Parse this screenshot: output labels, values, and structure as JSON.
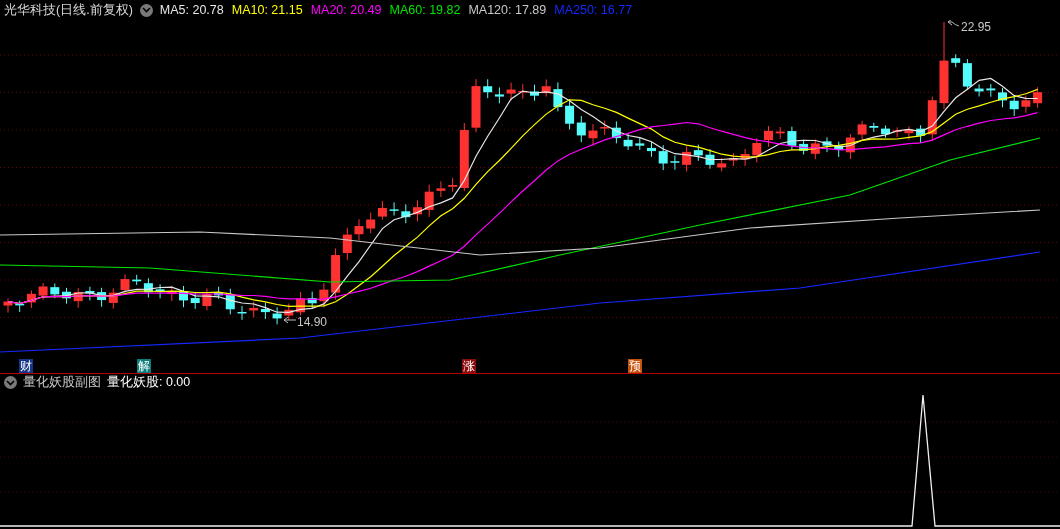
{
  "main_chart": {
    "title": "光华科技(日线.前复权)",
    "ma_legend": [
      {
        "label": "MA5: 20.78",
        "color": "#e6e6e6"
      },
      {
        "label": "MA10: 21.15",
        "color": "#ffff00"
      },
      {
        "label": "MA20: 20.49",
        "color": "#ff00ff"
      },
      {
        "label": "MA60: 19.82",
        "color": "#00e600"
      },
      {
        "label": "MA120: 17.89",
        "color": "#c8c8c8"
      },
      {
        "label": "MA250: 16.77",
        "color": "#1428ff"
      }
    ],
    "high_label": "22.95",
    "low_label": "14.90",
    "markers": [
      {
        "label": "财",
        "color": "#16358a"
      },
      {
        "label": "解",
        "color": "#0b7d7d"
      },
      {
        "label": "涨",
        "color": "#8c0c0c"
      },
      {
        "label": "预",
        "color": "#c4520c"
      }
    ]
  },
  "sub_chart": {
    "title": "量化妖股副图",
    "indicator": "量化妖股: 0.00"
  }
}
